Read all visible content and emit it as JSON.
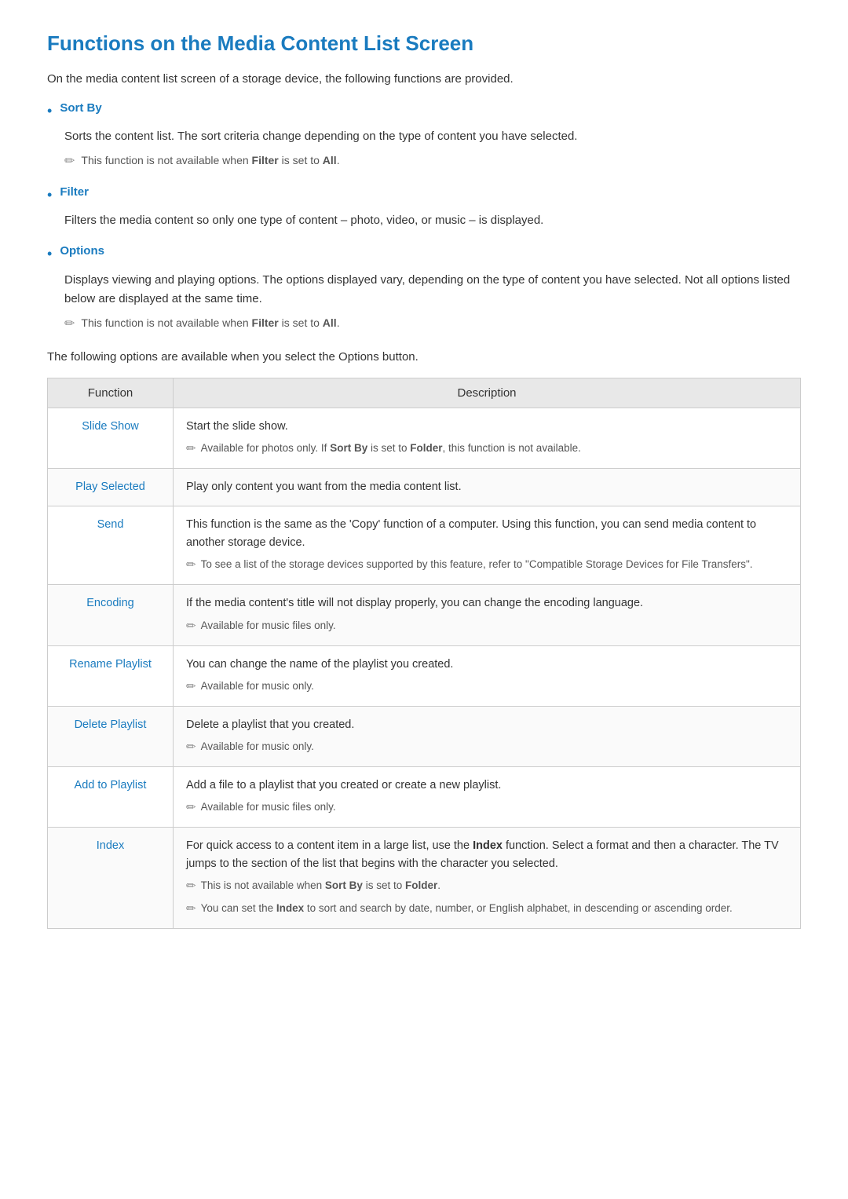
{
  "page": {
    "title": "Functions on the Media Content List Screen",
    "intro": "On the media content list screen of a storage device, the following functions are provided.",
    "bullets": [
      {
        "label": "Sort By",
        "description": "Sorts the content list. The sort criteria change depending on the type of content you have selected.",
        "note": "This function is not available when Filter is set to All.",
        "note_highlights": [
          "Filter",
          "All"
        ]
      },
      {
        "label": "Filter",
        "description": "Filters the media content so only one type of content – photo, video, or music – is displayed.",
        "note": null
      },
      {
        "label": "Options",
        "description": "Displays viewing and playing options. The options displayed vary, depending on the type of content you have selected. Not all options listed below are displayed at the same time.",
        "note": "This function is not available when Filter is set to All.",
        "note_highlights": [
          "Filter",
          "All"
        ]
      }
    ],
    "table_intro": "The following options are available when you select the Options button.",
    "table": {
      "col_function": "Function",
      "col_description": "Description",
      "rows": [
        {
          "function": "Slide Show",
          "description": "Start the slide show.",
          "notes": [
            "Available for photos only. If Sort By is set to Folder, this function is not available."
          ]
        },
        {
          "function": "Play Selected",
          "description": "Play only content you want from the media content list.",
          "notes": []
        },
        {
          "function": "Send",
          "description": "This function is the same as the 'Copy' function of a computer. Using this function, you can send media content to another storage device.",
          "notes": [
            "To see a list of the storage devices supported by this feature, refer to \"Compatible Storage Devices for File Transfers\"."
          ]
        },
        {
          "function": "Encoding",
          "description": "If the media content's title will not display properly, you can change the encoding language.",
          "notes": [
            "Available for music files only."
          ]
        },
        {
          "function": "Rename Playlist",
          "description": "You can change the name of the playlist you created.",
          "notes": [
            "Available for music only."
          ]
        },
        {
          "function": "Delete Playlist",
          "description": "Delete a playlist that you created.",
          "notes": [
            "Available for music only."
          ]
        },
        {
          "function": "Add to Playlist",
          "description": "Add a file to a playlist that you created or create a new playlist.",
          "notes": [
            "Available for music files only."
          ]
        },
        {
          "function": "Index",
          "description": "For quick access to a content item in a large list, use the Index function. Select a format and then a character. The TV jumps to the section of the list that begins with the character you selected.",
          "notes": [
            "This is not available when Sort By is set to Folder.",
            "You can set the Index to sort and search by date, number, or English alphabet, in descending or ascending order."
          ]
        }
      ]
    }
  }
}
